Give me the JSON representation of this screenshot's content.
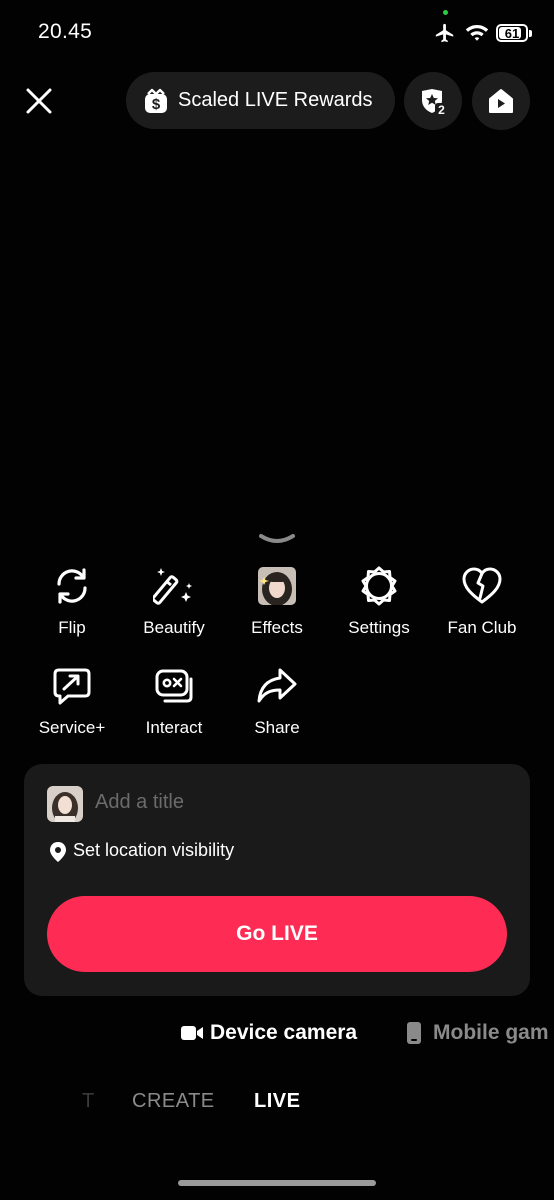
{
  "status_bar": {
    "time": "20.45",
    "battery": "61"
  },
  "top": {
    "rewards_label": "Scaled LIVE Rewards",
    "rank_badge": "2"
  },
  "tools": [
    {
      "label": "Flip",
      "icon": "flip-icon"
    },
    {
      "label": "Beautify",
      "icon": "beautify-wand-icon"
    },
    {
      "label": "Effects",
      "icon": "effects-thumbnail"
    },
    {
      "label": "Settings",
      "icon": "settings-gear-icon"
    },
    {
      "label": "Fan Club",
      "icon": "heart-icon"
    },
    {
      "label": "Service+",
      "icon": "service-chat-icon"
    },
    {
      "label": "Interact",
      "icon": "interact-game-icon"
    },
    {
      "label": "Share",
      "icon": "share-arrow-icon"
    }
  ],
  "card": {
    "title_placeholder": "Add a title",
    "location_label": "Set location visibility",
    "go_live_label": "Go LIVE"
  },
  "sources": {
    "device_camera": "Device camera",
    "mobile_game": "Mobile gam"
  },
  "modes": {
    "partial": "T",
    "create": "CREATE",
    "live": "LIVE"
  }
}
